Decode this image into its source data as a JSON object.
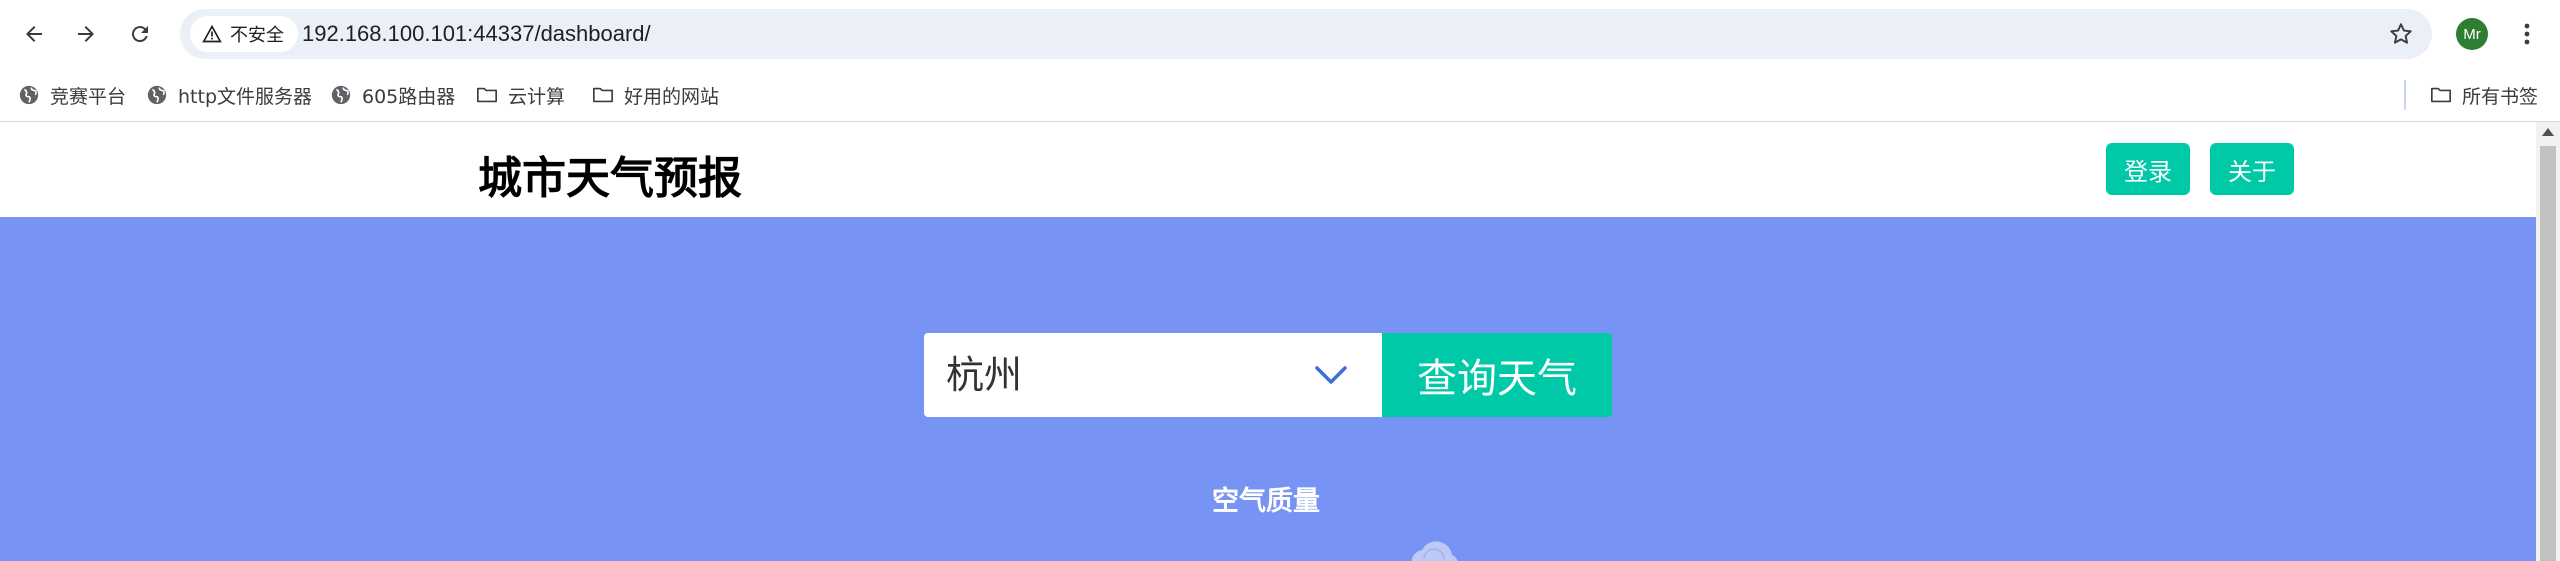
{
  "browser": {
    "security_label": "不安全",
    "url": "192.168.100.101:44337/dashboard/",
    "avatar_text": "Mr",
    "icons": [
      "back-icon",
      "forward-icon",
      "reload-icon",
      "warning-icon",
      "star-icon",
      "more-icon"
    ]
  },
  "bookmarks": {
    "items": [
      {
        "label": "竞赛平台",
        "icon": "globe-icon"
      },
      {
        "label": "http文件服务器",
        "icon": "globe-icon"
      },
      {
        "label": "605路由器",
        "icon": "globe-icon"
      },
      {
        "label": "云计算",
        "icon": "folder-icon"
      },
      {
        "label": "好用的网站",
        "icon": "folder-icon"
      }
    ],
    "all_bookmarks": "所有书签"
  },
  "page": {
    "title": "城市天气预报",
    "login_label": "登录",
    "about_label": "关于",
    "city_selected": "杭州",
    "query_label": "查询天气",
    "air_quality_label": "空气质量"
  },
  "colors": {
    "accent": "#00c9a7",
    "hero_background": "#7793f4",
    "chevron": "#3b6fd8"
  }
}
